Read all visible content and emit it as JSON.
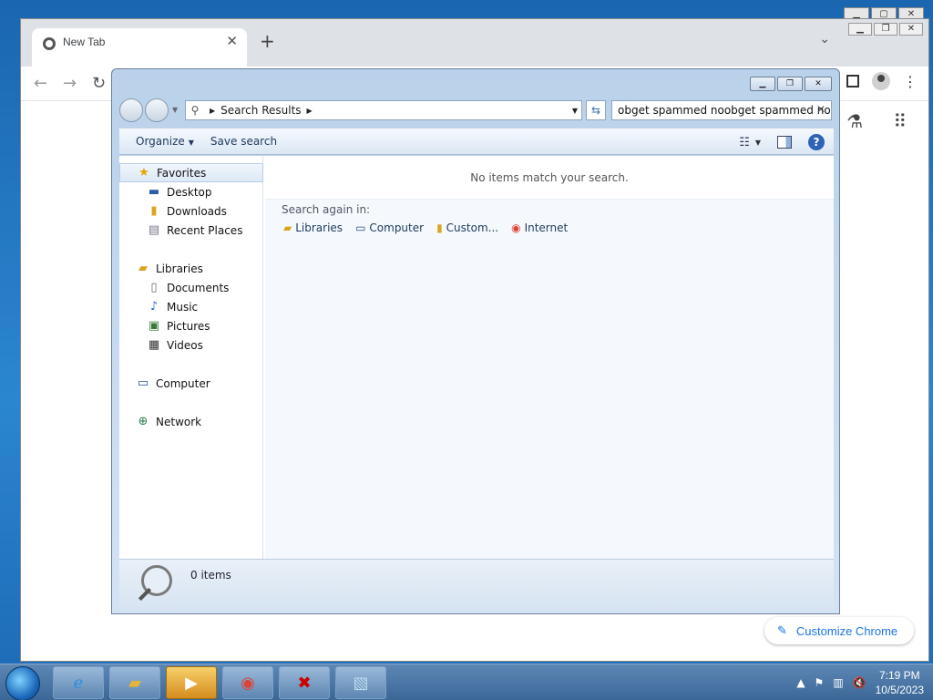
{
  "chrome": {
    "tab_title": "New Tab",
    "tab_close": "✕",
    "new_tab": "+",
    "tab_search": "⌄",
    "customize_label": "Customize Chrome"
  },
  "explorer": {
    "address_crumb": "Search Results",
    "search_query": "obget spammed noobget spammed noobget spammed",
    "commands": {
      "organize": "Organize",
      "save_search": "Save search"
    },
    "nav": {
      "favorites": {
        "label": "Favorites",
        "items": [
          "Desktop",
          "Downloads",
          "Recent Places"
        ]
      },
      "libraries": {
        "label": "Libraries",
        "items": [
          "Documents",
          "Music",
          "Pictures",
          "Videos"
        ]
      },
      "computer": "Computer",
      "network": "Network"
    },
    "no_match": "No items match your search.",
    "search_again_label": "Search again in:",
    "search_again_items": [
      "Libraries",
      "Computer",
      "Custom...",
      "Internet"
    ],
    "items_count": "0 items"
  },
  "taskbar": {
    "time": "7:19 PM",
    "date": "10/5/2023"
  },
  "colors": {
    "chrome_accent": "#1a73e8",
    "explorer_frame": "#b9d1ea",
    "taskbar": "#3b6797"
  }
}
